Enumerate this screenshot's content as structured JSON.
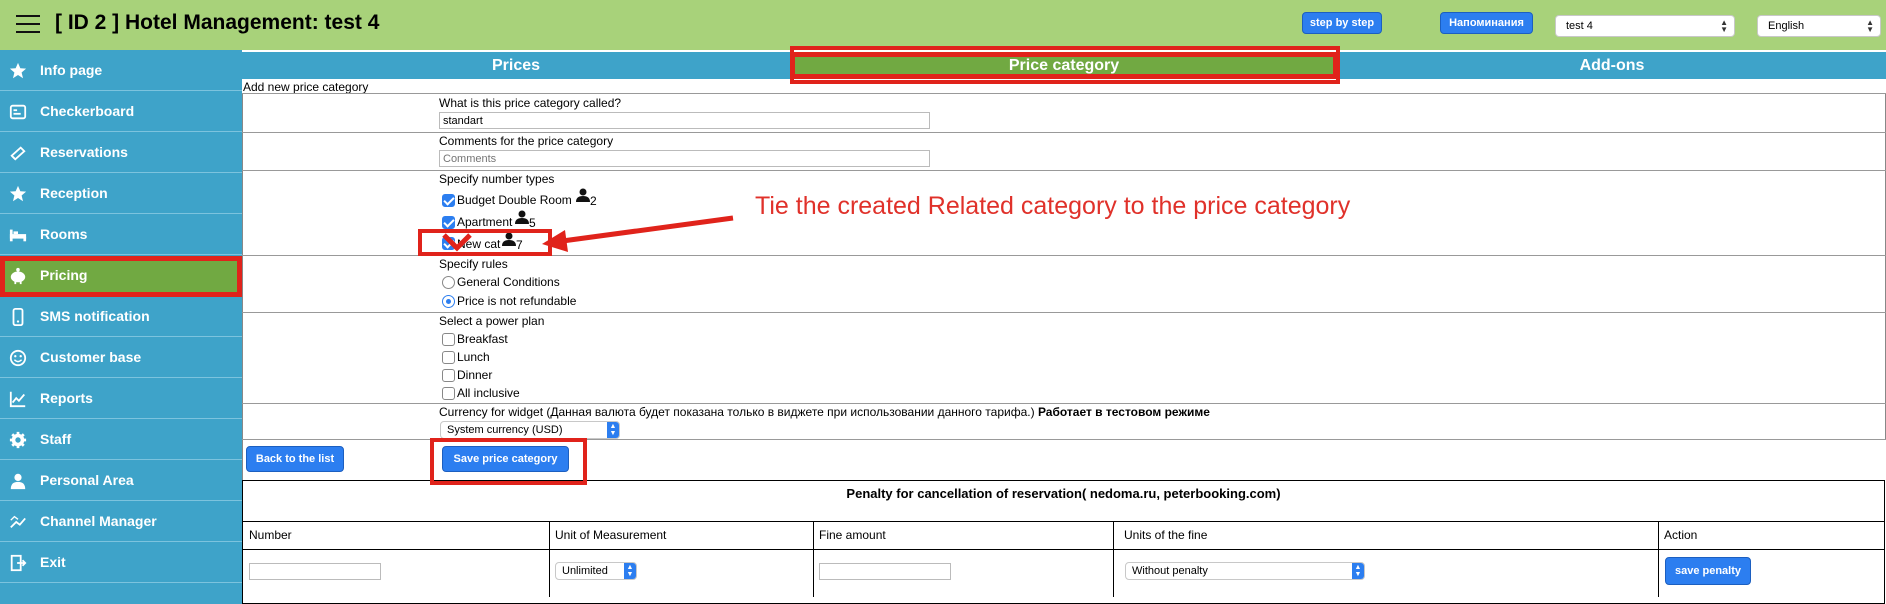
{
  "header": {
    "title": "[ ID 2 ] Hotel Management: test 4",
    "step_by_step": "step by step",
    "reminders": "Напоминания",
    "hotel_select": "test 4",
    "language_select": "English"
  },
  "sidebar": {
    "items": [
      {
        "label": "Info page",
        "icon": "star-icon"
      },
      {
        "label": "Checkerboard",
        "icon": "checkerboard-icon"
      },
      {
        "label": "Reservations",
        "icon": "reservations-icon"
      },
      {
        "label": "Reception",
        "icon": "star-icon"
      },
      {
        "label": "Rooms",
        "icon": "bed-icon"
      },
      {
        "label": "Pricing",
        "icon": "piggy-bank-icon"
      },
      {
        "label": "SMS notification",
        "icon": "sms-icon"
      },
      {
        "label": "Customer base",
        "icon": "customer-icon"
      },
      {
        "label": "Reports",
        "icon": "chart-icon"
      },
      {
        "label": "Staff",
        "icon": "gear-icon"
      },
      {
        "label": "Personal Area",
        "icon": "user-icon"
      },
      {
        "label": "Channel Manager",
        "icon": "channel-icon"
      },
      {
        "label": "Exit",
        "icon": "exit-icon"
      }
    ],
    "active": "Pricing"
  },
  "tabs": [
    "Prices",
    "Price category",
    "Add-ons"
  ],
  "active_tab": "Price category",
  "form": {
    "caption": "Add new price category",
    "name_label": "What is this price category called?",
    "name_value": "standart",
    "comments_label": "Comments for the price category",
    "comments_placeholder": "Comments",
    "room_types_label": "Specify number types",
    "room_types": [
      {
        "name": "Budget Double Room",
        "count": "2",
        "checked": true
      },
      {
        "name": "Apartment",
        "count": "5",
        "checked": true
      },
      {
        "name": "New cat",
        "count": "7",
        "checked": true
      }
    ],
    "rules_label": "Specify rules",
    "rules": [
      {
        "label": "General Conditions",
        "selected": false
      },
      {
        "label": "Price is not refundable",
        "selected": true
      }
    ],
    "meal_label": "Select a power plan",
    "meals": [
      "Breakfast",
      "Lunch",
      "Dinner",
      "All inclusive"
    ],
    "currency_label": "Currency for widget (Данная валюта будет показана только в виджете при использовании данного тарифа.)",
    "currency_note": "Работает в тестовом режиме",
    "currency_value": "System currency (USD)",
    "back_button": "Back to the list",
    "save_button": "Save price category"
  },
  "annotation": "Tie the created Related category to the price category",
  "penalty": {
    "title": "Penalty for cancellation of reservation( nedoma.ru, peterbooking.com)",
    "columns": [
      "Number",
      "Unit of Measurement",
      "Fine amount",
      "Units of the fine",
      "Action"
    ],
    "unit_value": "Unlimited",
    "fine_units_value": "Without penalty",
    "save_button": "save penalty"
  },
  "colors": {
    "header_bg": "#a8d27a",
    "sidebar_bg": "#3ea3c9",
    "active_green": "#71a942",
    "accent_blue": "#2c7ef0",
    "highlight_red": "#e0231b"
  }
}
